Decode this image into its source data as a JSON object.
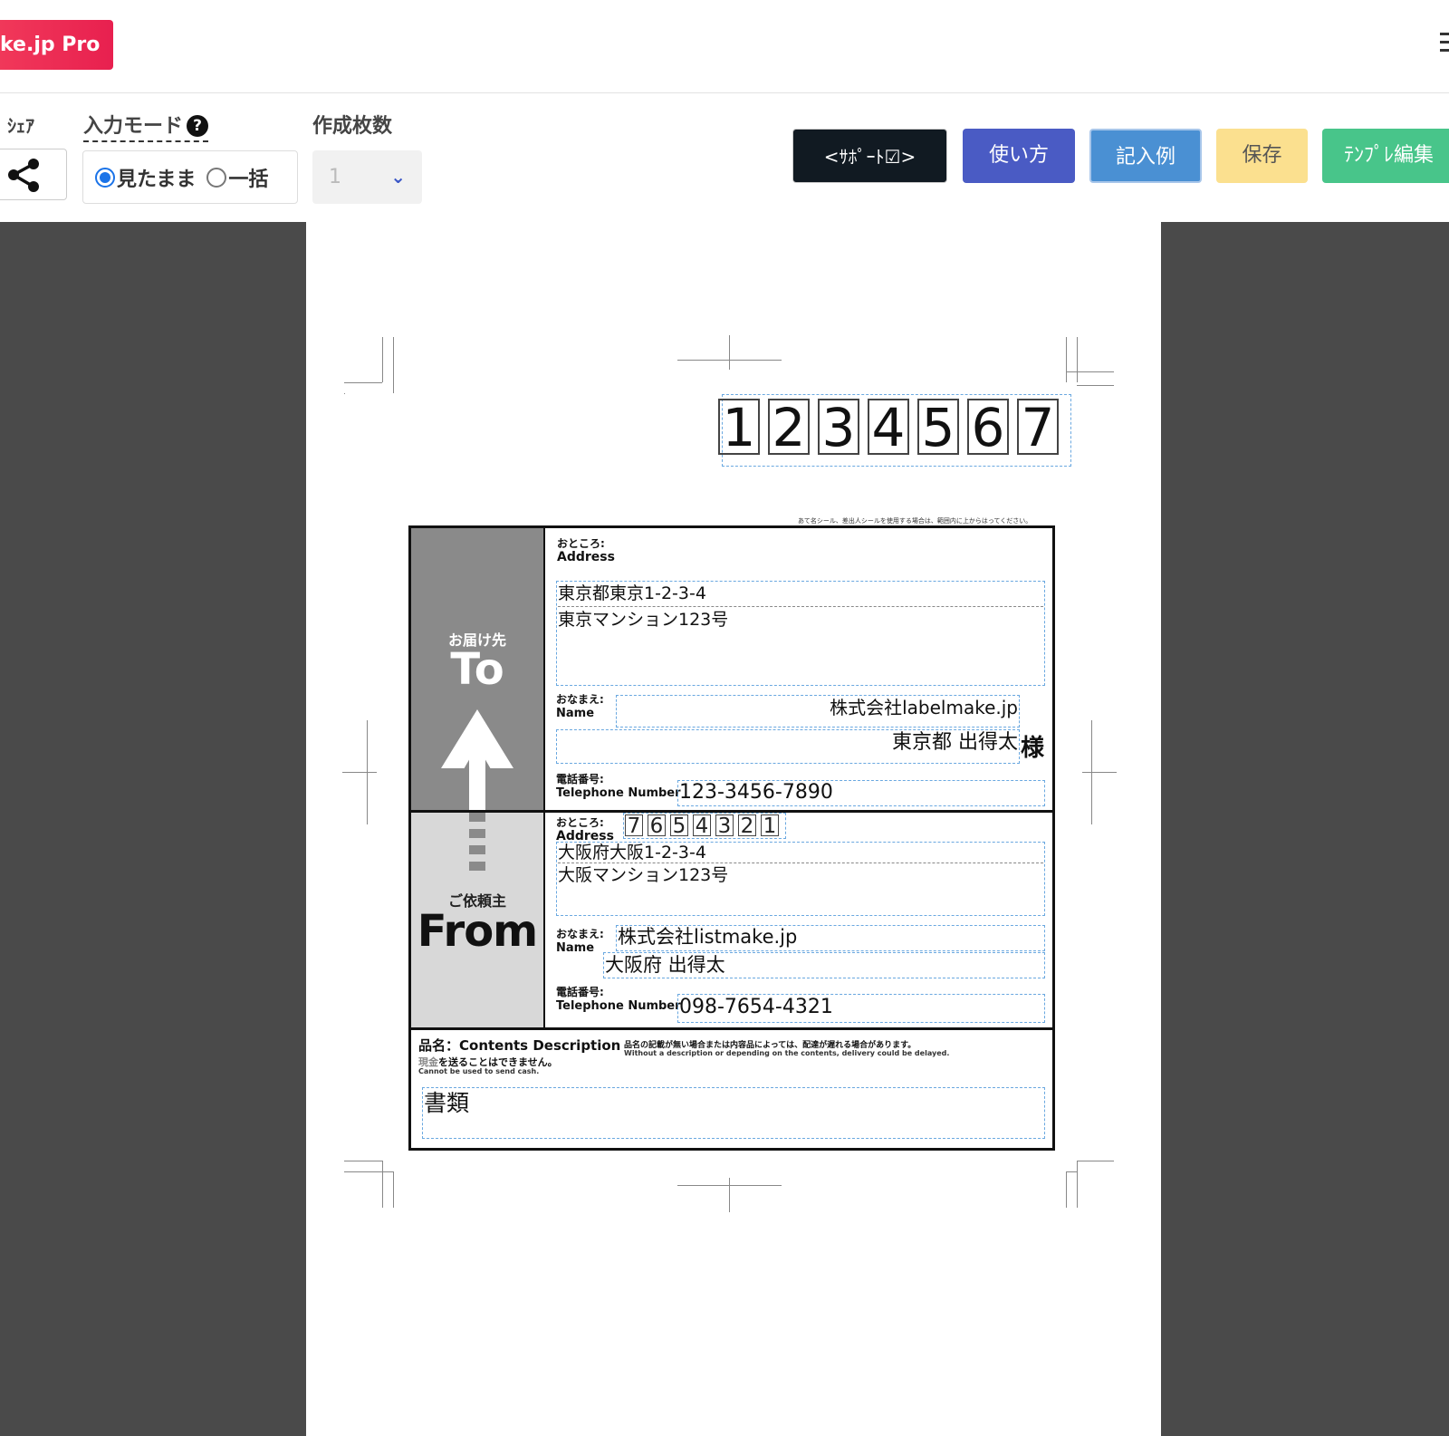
{
  "app": {
    "brand": "ke.jp Pro"
  },
  "toolbar": {
    "share_label": "ｼｪｱ",
    "mode_label": "入力モード",
    "help": "?",
    "mode_options": [
      "見たまま",
      "一括"
    ],
    "count_label": "作成枚数",
    "count_value": "1",
    "buttons": {
      "support": "<ｻﾎﾟｰﾄ☑>",
      "howto": "使い方",
      "example": "記入例",
      "save": "保存",
      "template": "ﾃﾝﾌﾟﾚ編集"
    }
  },
  "label": {
    "zip_digits": [
      "1",
      "2",
      "3",
      "4",
      "5",
      "6",
      "7"
    ],
    "note": "あて名シール、差出人シールを使用する場合は、範囲内に上からはってください。",
    "to": {
      "band_jp": "お届け先",
      "band_en": "To",
      "address_label_jp": "おところ:",
      "address_label_en": "Address",
      "address_line1": "東京都東京1-2-3-4",
      "address_line2": "東京マンション123号",
      "name_label_jp": "おなまえ:",
      "name_label_en": "Name",
      "company": "株式会社labelmake.jp",
      "person": "東京都 出得太",
      "honorific": "様",
      "tel_label_jp": "電話番号:",
      "tel_label_en": "Telephone Number",
      "tel": "123-3456-7890"
    },
    "from": {
      "band_jp": "ご依頼主",
      "band_en": "From",
      "address_label_jp": "おところ:",
      "address_label_en": "Address",
      "zip_digits": [
        "7",
        "6",
        "5",
        "4",
        "3",
        "2",
        "1"
      ],
      "address_line1": "大阪府大阪1-2-3-4",
      "address_line2": "大阪マンション123号",
      "name_label_jp": "おなまえ:",
      "name_label_en": "Name",
      "company": "株式会社listmake.jp",
      "person": "大阪府 出得太",
      "tel_label_jp": "電話番号:",
      "tel_label_en": "Telephone Number",
      "tel": "098-7654-4321"
    },
    "contents": {
      "title": "品名：Contents Description",
      "note_jp": "品名の記載が無い場合または内容品によっては、配達が遅れる場合があります。",
      "note_en": "Without a description or depending on the contents, delivery could be delayed.",
      "cash_word": "現金",
      "cash_jp": "を送ることはできません。",
      "cash_en": "Cannot be used to send cash.",
      "value": "書類"
    }
  }
}
